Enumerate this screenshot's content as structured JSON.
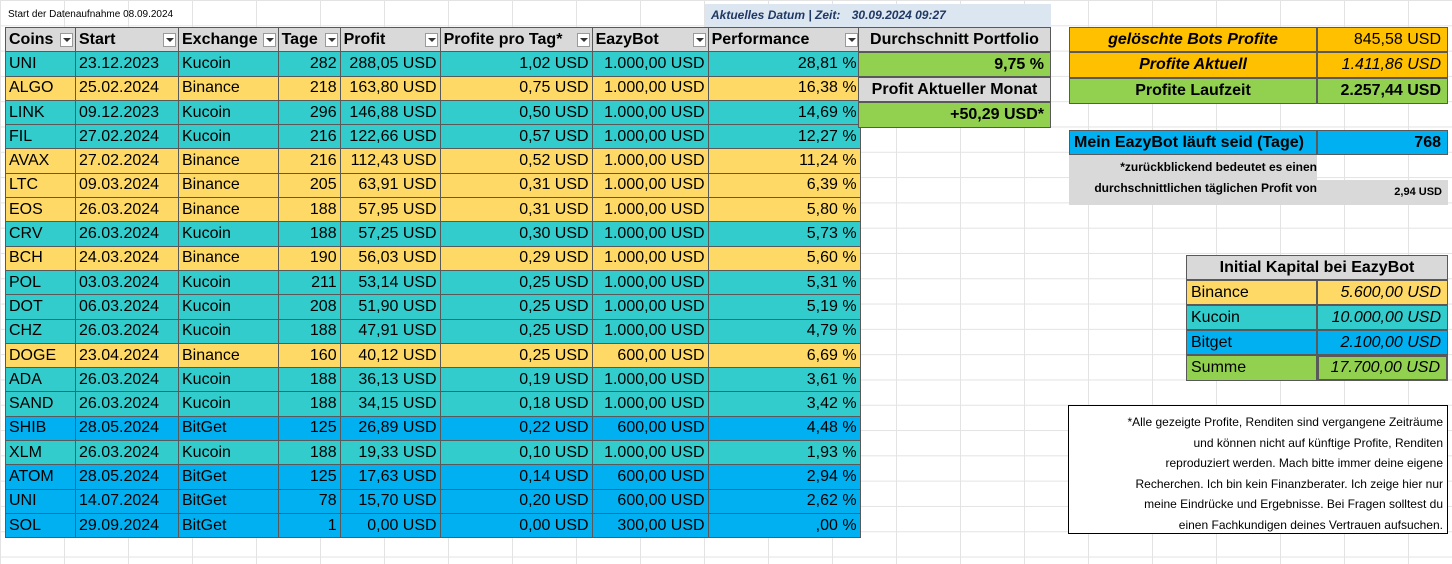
{
  "sheet": {
    "data_start_note": "Start der Datenaufnahme 08.09.2024",
    "current_date_label": "Aktuelles Datum | Zeit:",
    "current_date_value": "30.09.2024 09:27"
  },
  "table": {
    "headers": [
      "Coins",
      "Start",
      "Exchange",
      "Tage",
      "Profit",
      "Profite pro Tag*",
      "EazyBot",
      "Performance"
    ],
    "rows": [
      {
        "coin": "UNI",
        "start": "23.12.2023",
        "exchange": "Kucoin",
        "tage": "282",
        "profit": "288,05 USD",
        "ppt": "1,02 USD",
        "eazybot": "1.000,00 USD",
        "perf": "28,81 %",
        "cls": "kucoin"
      },
      {
        "coin": "ALGO",
        "start": "25.02.2024",
        "exchange": "Binance",
        "tage": "218",
        "profit": "163,80 USD",
        "ppt": "0,75 USD",
        "eazybot": "1.000,00 USD",
        "perf": "16,38 %",
        "cls": "binance"
      },
      {
        "coin": "LINK",
        "start": "09.12.2023",
        "exchange": "Kucoin",
        "tage": "296",
        "profit": "146,88 USD",
        "ppt": "0,50 USD",
        "eazybot": "1.000,00 USD",
        "perf": "14,69 %",
        "cls": "kucoin"
      },
      {
        "coin": "FIL",
        "start": "27.02.2024",
        "exchange": "Kucoin",
        "tage": "216",
        "profit": "122,66 USD",
        "ppt": "0,57 USD",
        "eazybot": "1.000,00 USD",
        "perf": "12,27 %",
        "cls": "kucoin"
      },
      {
        "coin": "AVAX",
        "start": "27.02.2024",
        "exchange": "Binance",
        "tage": "216",
        "profit": "112,43 USD",
        "ppt": "0,52 USD",
        "eazybot": "1.000,00 USD",
        "perf": "11,24 %",
        "cls": "binance"
      },
      {
        "coin": "LTC",
        "start": "09.03.2024",
        "exchange": "Binance",
        "tage": "205",
        "profit": "63,91 USD",
        "ppt": "0,31 USD",
        "eazybot": "1.000,00 USD",
        "perf": "6,39 %",
        "cls": "binance"
      },
      {
        "coin": "EOS",
        "start": "26.03.2024",
        "exchange": "Binance",
        "tage": "188",
        "profit": "57,95 USD",
        "ppt": "0,31 USD",
        "eazybot": "1.000,00 USD",
        "perf": "5,80 %",
        "cls": "binance"
      },
      {
        "coin": "CRV",
        "start": "26.03.2024",
        "exchange": "Kucoin",
        "tage": "188",
        "profit": "57,25 USD",
        "ppt": "0,30 USD",
        "eazybot": "1.000,00 USD",
        "perf": "5,73 %",
        "cls": "kucoin"
      },
      {
        "coin": "BCH",
        "start": "24.03.2024",
        "exchange": "Binance",
        "tage": "190",
        "profit": "56,03 USD",
        "ppt": "0,29 USD",
        "eazybot": "1.000,00 USD",
        "perf": "5,60 %",
        "cls": "binance"
      },
      {
        "coin": "POL",
        "start": "03.03.2024",
        "exchange": "Kucoin",
        "tage": "211",
        "profit": "53,14 USD",
        "ppt": "0,25 USD",
        "eazybot": "1.000,00 USD",
        "perf": "5,31 %",
        "cls": "kucoin"
      },
      {
        "coin": "DOT",
        "start": "06.03.2024",
        "exchange": "Kucoin",
        "tage": "208",
        "profit": "51,90 USD",
        "ppt": "0,25 USD",
        "eazybot": "1.000,00 USD",
        "perf": "5,19 %",
        "cls": "kucoin"
      },
      {
        "coin": "CHZ",
        "start": "26.03.2024",
        "exchange": "Kucoin",
        "tage": "188",
        "profit": "47,91 USD",
        "ppt": "0,25 USD",
        "eazybot": "1.000,00 USD",
        "perf": "4,79 %",
        "cls": "kucoin"
      },
      {
        "coin": "DOGE",
        "start": "23.04.2024",
        "exchange": "Binance",
        "tage": "160",
        "profit": "40,12 USD",
        "ppt": "0,25 USD",
        "eazybot": "600,00 USD",
        "perf": "6,69 %",
        "cls": "binance"
      },
      {
        "coin": "ADA",
        "start": "26.03.2024",
        "exchange": "Kucoin",
        "tage": "188",
        "profit": "36,13 USD",
        "ppt": "0,19 USD",
        "eazybot": "1.000,00 USD",
        "perf": "3,61 %",
        "cls": "kucoin"
      },
      {
        "coin": "SAND",
        "start": "26.03.2024",
        "exchange": "Kucoin",
        "tage": "188",
        "profit": "34,15 USD",
        "ppt": "0,18 USD",
        "eazybot": "1.000,00 USD",
        "perf": "3,42 %",
        "cls": "kucoin"
      },
      {
        "coin": "SHIB",
        "start": "28.05.2024",
        "exchange": "BitGet",
        "tage": "125",
        "profit": "26,89 USD",
        "ppt": "0,22 USD",
        "eazybot": "600,00 USD",
        "perf": "4,48 %",
        "cls": "bitget"
      },
      {
        "coin": "XLM",
        "start": "26.03.2024",
        "exchange": "Kucoin",
        "tage": "188",
        "profit": "19,33 USD",
        "ppt": "0,10 USD",
        "eazybot": "1.000,00 USD",
        "perf": "1,93 %",
        "cls": "kucoin"
      },
      {
        "coin": "ATOM",
        "start": "28.05.2024",
        "exchange": "BitGet",
        "tage": "125",
        "profit": "17,63 USD",
        "ppt": "0,14 USD",
        "eazybot": "600,00 USD",
        "perf": "2,94 %",
        "cls": "bitget"
      },
      {
        "coin": "UNI",
        "start": "14.07.2024",
        "exchange": "BitGet",
        "tage": "78",
        "profit": "15,70 USD",
        "ppt": "0,20 USD",
        "eazybot": "600,00 USD",
        "perf": "2,62 %",
        "cls": "bitget"
      },
      {
        "coin": "SOL",
        "start": "29.09.2024",
        "exchange": "BitGet",
        "tage": "1",
        "profit": "0,00 USD",
        "ppt": "0,00 USD",
        "eazybot": "300,00 USD",
        "perf": ",00 %",
        "cls": "bitget"
      }
    ]
  },
  "portfolio": {
    "avg_label": "Durchschnitt Portfolio",
    "avg_value": "9,75 %",
    "month_label": "Profit Aktueller Monat",
    "month_value": "+50,29 USD*"
  },
  "summary": {
    "deleted_label": "gelöschte Bots Profite",
    "deleted_value": "845,58 USD",
    "current_label": "Profite Aktuell",
    "current_value": "1.411,86 USD",
    "runtime_label": "Profite Laufzeit",
    "runtime_value": "2.257,44 USD"
  },
  "runtime_days": {
    "label": "Mein EazyBot läuft seid (Tage)",
    "value": "768",
    "note_line1": "*zurückblickend bedeutet es einen",
    "note_line2": "durchschnittlichen täglichen Profit von",
    "daily_value": "2,94 USD"
  },
  "capital": {
    "title": "Initial Kapital bei EazyBot",
    "rows": [
      {
        "label": "Binance",
        "value": "5.600,00 USD"
      },
      {
        "label": "Kucoin",
        "value": "10.000,00 USD"
      },
      {
        "label": "Bitget",
        "value": "2.100,00 USD"
      },
      {
        "label": "Summe",
        "value": "17.700,00 USD"
      }
    ]
  },
  "disclaimer": {
    "lines": [
      "*Alle gezeigte Profite, Renditen sind vergangene Zeiträume",
      "und können nicht auf künftige Profite, Renditen",
      "reproduziert werden. Mach bitte immer deine eigene",
      "Recherchen. Ich bin kein Finanzberater. Ich zeige hier nur",
      "meine Eindrücke und Ergebnisse. Bei Fragen solltest du",
      "einen Fachkundigen deines Vertrauen aufsuchen."
    ]
  },
  "colors": {
    "kucoin": "#33cccc",
    "binance": "#ffd966",
    "bitget": "#00b0f0",
    "green": "#92d050",
    "orange": "#ffc000",
    "header_gray": "#d9d9d9"
  }
}
